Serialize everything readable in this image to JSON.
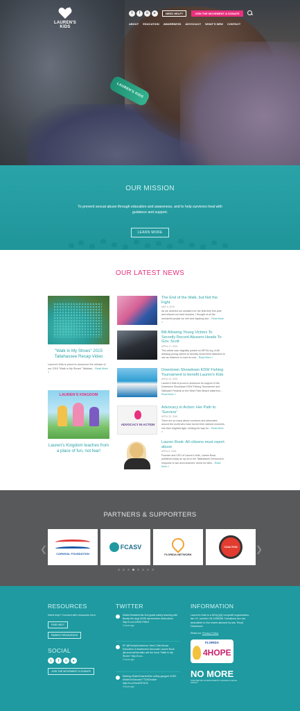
{
  "header": {
    "logo_text": "LAUREN'S KIDS",
    "social_icons": [
      "twitter-icon",
      "facebook-icon",
      "instagram-icon",
      "youtube-icon"
    ],
    "need_help_label": "NEED HELP?",
    "join_label": "JOIN THE MOVEMENT & DONATE",
    "nav": [
      "ABOUT",
      "EDUCATION",
      "AWARENESS",
      "ADVOCACY",
      "WHAT'S NEW",
      "CONTACT"
    ],
    "wristband_text": "LAUREN'S KIDS"
  },
  "mission": {
    "title": "OUR MISSION",
    "text": "To prevent sexual abuse through education and awareness, and to help survivors heal with guidance and support.",
    "button": "LEARN MORE"
  },
  "news": {
    "title": "OUR LATEST NEWS",
    "featured": [
      {
        "title": "\"Walk in My Shoes\" 2015 Tallahassee Recap Video",
        "excerpt": "Lauren's Kids is proud to announce the release of our 2015 \"Walk in My Shoes\" Tallahas...",
        "more": "Read More »"
      },
      {
        "title": "Lauren's Kingdom teaches from a place of fun, not fear!",
        "excerpt": "",
        "more": "",
        "image_text": "LAUREN'S KINGDOM"
      }
    ],
    "items": [
      {
        "title": "The End of the Walk, but Not the Fight",
        "date": "MAY 5, 2015",
        "excerpt": "As we ushered our sneakers for the final time this year and relaxed our tired muscles, I thought of all the wonderful people we met and inspiring stor...",
        "more": "Read More »"
      },
      {
        "title": "Bill Allowing Young Victims To Secretly Record Abusers Heads To Gov. Scott",
        "date": "APRIL 27, 2015",
        "excerpt": "This article was originally posted on WFSU.org. A bill allowing young victims to secretly record their attackers to use as evidence in court is now...",
        "more": "Read More »"
      },
      {
        "title": "Downtown Showdown KDW Fishing Tournament to benefit Lauren's Kids",
        "date": "APRIL 22, 2015",
        "excerpt": "Lauren's Kids is proud to announce its support of the Downtown Showdown KDW Fishing Tournament and Saltwater Festival on the West Palm Beach waterfron...",
        "more": "Read More »"
      },
      {
        "title": "Advocacy in Action: Her Path to 'Survivor'",
        "date": "APRIL 20, 2015",
        "excerpt": "There are so many abuse survivors and advocates around the world who have turned their darkest moments into their brightest light, shining the way for...",
        "more": "Read More »",
        "image_text": "ADVOCACY IN ACTION"
      },
      {
        "title": "Lauren Book: All citizens must report abuse",
        "date": "APRIL 8, 2015",
        "excerpt": "Founder and CEO of Lauren's Kids, Lauren Book, published today an op-ed in the Tallahassee Democrat in response to two area teachers' arrest for failin...",
        "more": "Read More »"
      }
    ]
  },
  "partners": {
    "title": "PARTNERS & SUPPORTERS",
    "logos": [
      "CARNIVAL FOUNDATION",
      "FCASV",
      "FLORIDA NETWORK",
      "COALITION"
    ],
    "dot_count": 8,
    "active_dot": 3
  },
  "footer": {
    "resources": {
      "title": "RESOURCES",
      "text": "Need help? Connect with resources here:",
      "find_help": "FIND HELP",
      "parent_resources": "PARENT RESOURCES"
    },
    "social": {
      "title": "SOCIAL",
      "icons": [
        "twitter-icon",
        "facebook-icon",
        "instagram-icon",
        "youtube-icon"
      ],
      "join": "JOIN THE MOVEMENT & DONATE"
    },
    "twitter": {
      "title": "TWITTER",
      "tweets": [
        {
          "text": "#SaferSmarterKids 2nd grade safety learning with Buddy the dog! #SSK #prevention #education http://t.co/LZW3K79NUI",
          "ago": "2 hours ago"
        },
        {
          "text": "RT @FloridaGreatness: Next Child Abuse Education & Awareness Advocate Lauren Book @LaurensKids talks abt her book \"Walk In My Shoes\" http://t.co/...",
          "ago": "2 hours ago"
        },
        {
          "text": "Making #SaferSmarterKids safety gauges! #SSK #SafeOnSchools? TOSDecider http://t.co/ZmsE3FZkTc",
          "ago": "3 hours ago"
        }
      ]
    },
    "information": {
      "title": "INFORMATION",
      "text": "Lauren's Kids is a 501(c)(3) nonprofit organization, tax I.D. number 26-1155098. Donations are tax-deductible to the extent allowed by law. Read Disclosure",
      "read_label": "Read our",
      "privacy": "Privacy Policy",
      "plate_state": "FLORIDA",
      "plate_text": "4HOPE",
      "nomore": "NO MORE",
      "nomore_sub": "TOGETHER WE CAN END DOMESTIC VIOLENCE & SEXUAL ASSAULT"
    }
  },
  "colors": {
    "teal": "#2aa3a8",
    "pink": "#e8307e",
    "partners_bg": "#58595b",
    "footer_bg": "#1e9aa0"
  }
}
